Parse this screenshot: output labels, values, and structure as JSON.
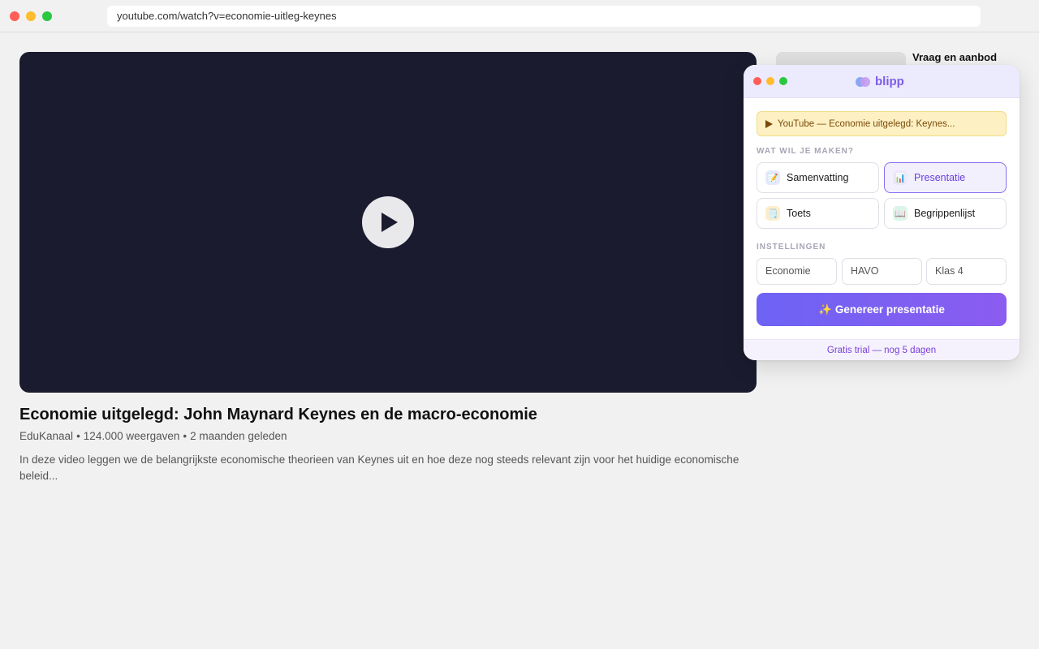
{
  "browser": {
    "url": "youtube.com/watch?v=economie-uitleg-keynes"
  },
  "video": {
    "title": "Economie uitgelegd: John Maynard Keynes en de macro-economie",
    "channel": "EduKanaal",
    "views": "124.000 weergaven",
    "age": "2 maanden geleden",
    "description": "In deze video leggen we de belangrijkste economische theorieen van Keynes uit en hoe deze nog steeds relevant zijn voor het huidige economische beleid..."
  },
  "sidebar": {
    "suggestion_title": "Vraag en aanbod"
  },
  "popup": {
    "brand": "blipp",
    "source": "YouTube — Economie uitgelegd: Keynes...",
    "section_make": "WAT WIL JE MAKEN?",
    "options": [
      {
        "label": "Samenvatting",
        "icon": "memo-icon",
        "glyph": "📝",
        "selected": false
      },
      {
        "label": "Presentatie",
        "icon": "bar-chart-icon",
        "glyph": "📊",
        "selected": true
      },
      {
        "label": "Toets",
        "icon": "notepad-icon",
        "glyph": "🗒️",
        "selected": false
      },
      {
        "label": "Begrippenlijst",
        "icon": "open-book-icon",
        "glyph": "📖",
        "selected": false
      }
    ],
    "section_settings": "INSTELLINGEN",
    "settings": {
      "subject": "Economie",
      "level": "HAVO",
      "grade": "Klas 4"
    },
    "generate_glyph": "✨",
    "generate_label": "Genereer presentatie",
    "footer": "Gratis trial — nog 5 dagen",
    "colors": {
      "accent": "#7c5ce6",
      "selected_border": "#8b6cf0",
      "banner_bg": "#fdf0c2",
      "button_gradient_start": "#6d63f4",
      "button_gradient_end": "#8b5cf0"
    }
  }
}
